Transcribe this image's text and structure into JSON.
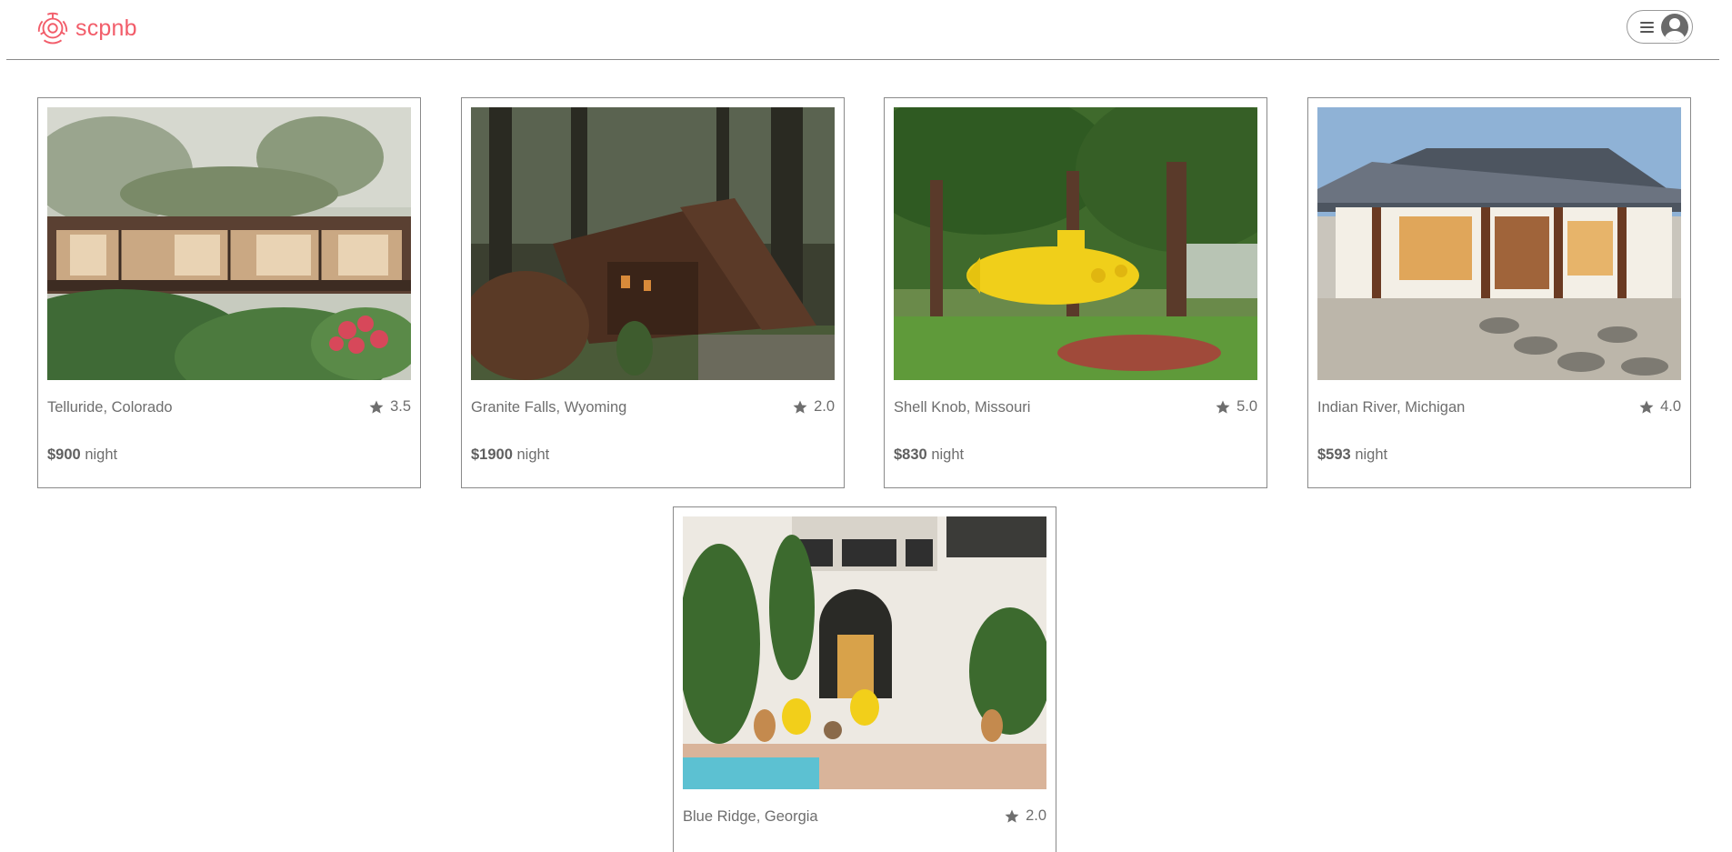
{
  "header": {
    "brand": "scpnb",
    "brand_color": "#f25d6a",
    "logo_icon": "scp-logo-icon",
    "menu_icon": "hamburger-icon",
    "avatar_icon": "user-avatar-icon"
  },
  "listings": [
    {
      "location": "Telluride, Colorado",
      "rating": "3.5",
      "price": "$900",
      "unit": "night",
      "photo": "glass-house-forest"
    },
    {
      "location": "Granite Falls, Wyoming",
      "rating": "2.0",
      "price": "$1900",
      "unit": "night",
      "photo": "a-frame-cabin-woods"
    },
    {
      "location": "Shell Knob, Missouri",
      "rating": "5.0",
      "price": "$830",
      "unit": "night",
      "photo": "yellow-submarine-trees"
    },
    {
      "location": "Indian River, Michigan",
      "rating": "4.0",
      "price": "$593",
      "unit": "night",
      "photo": "hanok-courtyard"
    },
    {
      "location": "Blue Ridge, Georgia",
      "rating": "2.0",
      "price": "",
      "unit": "",
      "photo": "riad-courtyard-pool"
    }
  ]
}
